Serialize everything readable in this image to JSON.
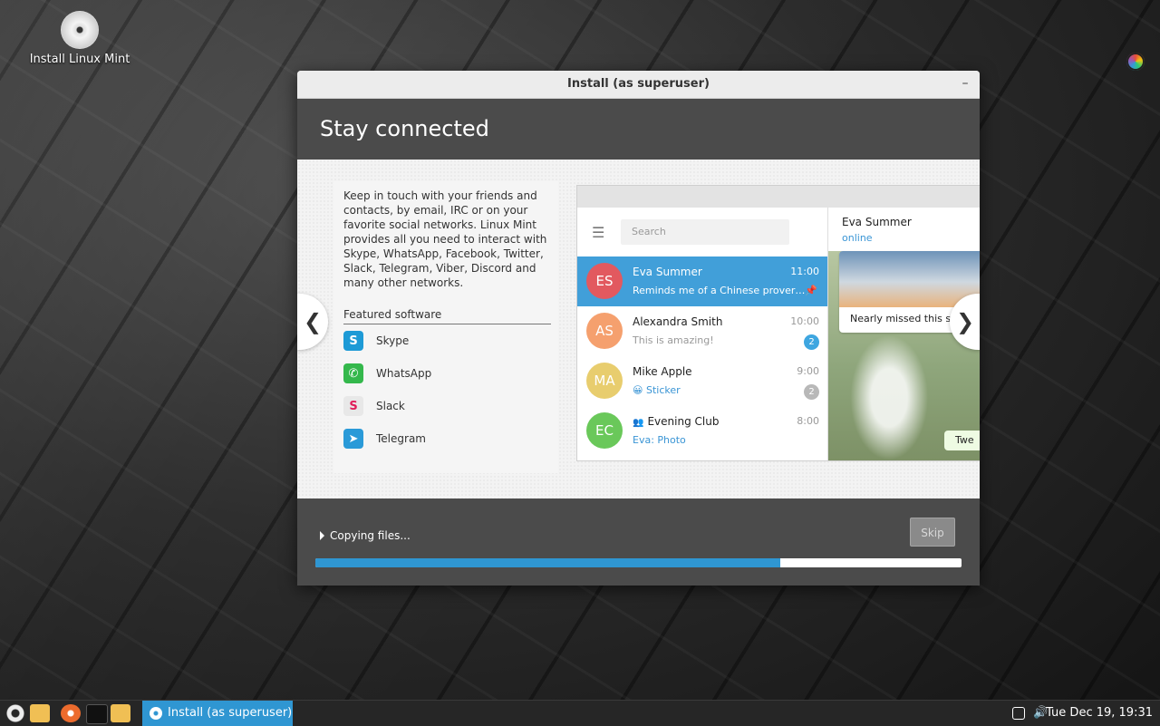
{
  "desktop": {
    "icon_label": "Install Linux Mint"
  },
  "window": {
    "title": "Install (as superuser)",
    "minimize_glyph": "–",
    "header": "Stay connected",
    "description": "Keep in touch with your friends and contacts, by email, IRC or on your favorite social networks. Linux Mint provides all you need to interact with Skype, WhatsApp, Facebook, Twitter, Slack, Telegram, Viber, Discord and many other networks.",
    "featured_title": "Featured software",
    "featured": [
      {
        "label": "Skype",
        "icon": "skype-icon",
        "color": "#1d9ad6",
        "glyph": "S"
      },
      {
        "label": "WhatsApp",
        "icon": "whatsapp-icon",
        "color": "#34b84c",
        "glyph": "✆"
      },
      {
        "label": "Slack",
        "icon": "slack-icon",
        "color": "#e8e8e8",
        "glyph": "S"
      },
      {
        "label": "Telegram",
        "icon": "telegram-icon",
        "color": "#2a9ad8",
        "glyph": "➤"
      }
    ],
    "prev_glyph": "❮",
    "next_glyph": "❯",
    "status": "Copying files...",
    "skip_label": "Skip",
    "progress": 0.72
  },
  "telegram": {
    "search_placeholder": "Search",
    "chats": [
      {
        "initials": "ES",
        "name": "Eva Summer",
        "time": "11:00",
        "msg": "Reminds me of a Chinese prover…",
        "color": "#e2595f",
        "active": true,
        "pinned": true
      },
      {
        "initials": "AS",
        "name": "Alexandra Smith",
        "time": "10:00",
        "msg": "This is amazing!",
        "color": "#f5a06e",
        "badge": "2",
        "badge_color": "#3ea6e0"
      },
      {
        "initials": "MA",
        "name": "Mike Apple",
        "time": "9:00",
        "msg": "😀 Sticker",
        "color": "#e8cd6e",
        "badge": "2",
        "badge_color": "#b8b8b8"
      },
      {
        "initials": "EC",
        "name": "Evening Club",
        "time": "8:00",
        "msg": "Eva: Photo",
        "color": "#6ac85a"
      }
    ],
    "contact_name": "Eva Summer",
    "contact_status": "online",
    "photo_caption": "Nearly missed this s",
    "reply_snippet": "Twe"
  },
  "taskbar": {
    "active_task": "Install (as superuser)",
    "clock": "Tue Dec 19, 19:31"
  }
}
